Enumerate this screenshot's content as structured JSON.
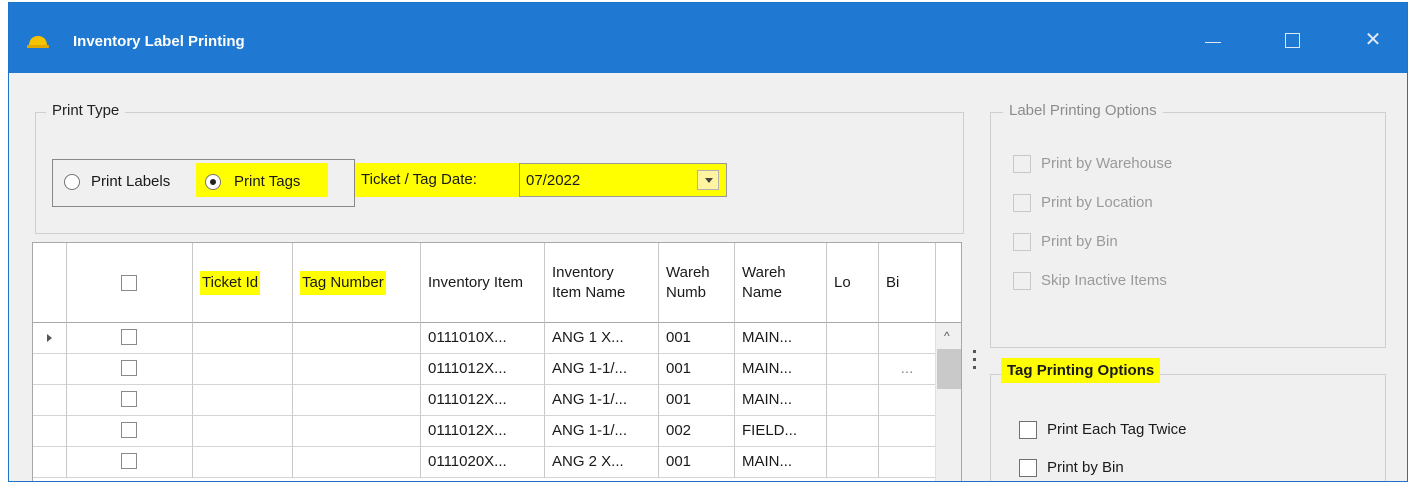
{
  "window": {
    "title": "Inventory Label Printing",
    "accent_color": "#1f78d1",
    "highlight_color": "#ffff00",
    "app_icon": "hard-hat-icon",
    "controls": {
      "minimize": "minimize-icon",
      "maximize": "maximize-icon",
      "close": "✕"
    }
  },
  "print_type": {
    "legend": "Print Type",
    "options": [
      "Print Labels",
      "Print Tags"
    ],
    "selected": "Print Tags",
    "date_label": "Ticket / Tag Date:",
    "date_value": "07/2022"
  },
  "grid": {
    "columns": [
      "Ticket Id",
      "Tag Number",
      "Inventory Item",
      "Inventory Item Name",
      "Wareh Numb",
      "Wareh Name",
      "Lo",
      "Bi"
    ],
    "rows": [
      {
        "ticket_id": "",
        "tag_number": "",
        "item": "0111010X...",
        "item_name": "ANG 1 X...",
        "wareh_numb": "001",
        "wareh_name": "MAIN...",
        "lo": "",
        "bi": ""
      },
      {
        "ticket_id": "",
        "tag_number": "",
        "item": "0111012X...",
        "item_name": "ANG 1-1/...",
        "wareh_numb": "001",
        "wareh_name": "MAIN...",
        "lo": "",
        "bi": "..."
      },
      {
        "ticket_id": "",
        "tag_number": "",
        "item": "0111012X...",
        "item_name": "ANG 1-1/...",
        "wareh_numb": "001",
        "wareh_name": "MAIN...",
        "lo": "",
        "bi": ""
      },
      {
        "ticket_id": "",
        "tag_number": "",
        "item": "0111012X...",
        "item_name": "ANG 1-1/...",
        "wareh_numb": "002",
        "wareh_name": "FIELD...",
        "lo": "",
        "bi": ""
      },
      {
        "ticket_id": "",
        "tag_number": "",
        "item": "0111020X...",
        "item_name": "ANG 2 X...",
        "wareh_numb": "001",
        "wareh_name": "MAIN...",
        "lo": "",
        "bi": ""
      }
    ],
    "scroll_up_glyph": "^"
  },
  "label_options": {
    "legend": "Label Printing Options",
    "items": [
      "Print by Warehouse",
      "Print by Location",
      "Print by Bin",
      "Skip Inactive Items"
    ]
  },
  "tag_options": {
    "legend": "Tag Printing Options",
    "items": [
      "Print Each Tag Twice",
      "Print by Bin"
    ]
  }
}
